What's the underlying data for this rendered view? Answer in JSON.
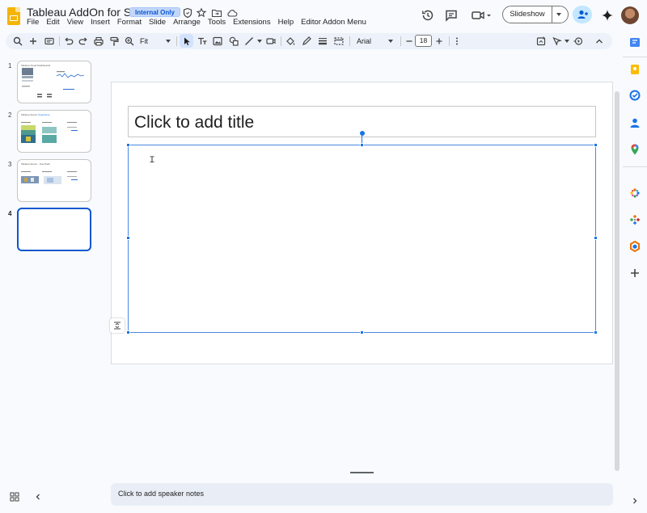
{
  "header": {
    "title": "Tableau AddOn for Slides",
    "badge": "Internal Only",
    "menu": [
      "File",
      "Edit",
      "View",
      "Insert",
      "Format",
      "Slide",
      "Arrange",
      "Tools",
      "Extensions",
      "Help",
      "Editor Addon Menu"
    ],
    "slideshow_label": "Slideshow"
  },
  "toolbar": {
    "zoom": "Fit",
    "font": "Arial",
    "font_size": "18"
  },
  "filmstrip": {
    "slides": [
      {
        "number": "1",
        "title": "Tableau Cloud Dashboards"
      },
      {
        "number": "2",
        "title": "Tableau Server",
        "link": "Superstore"
      },
      {
        "number": "3",
        "title": "Tableau Server - Test Pack"
      },
      {
        "number": "4",
        "title": ""
      }
    ]
  },
  "slide": {
    "title_placeholder": "Click to add title"
  },
  "notes": {
    "placeholder": "Click to add speaker notes"
  },
  "colors": {
    "accent": "#0b57d0",
    "selection": "#1a73e8",
    "badge_bg": "#c2d7fa",
    "app_icon": "#f4b400"
  }
}
